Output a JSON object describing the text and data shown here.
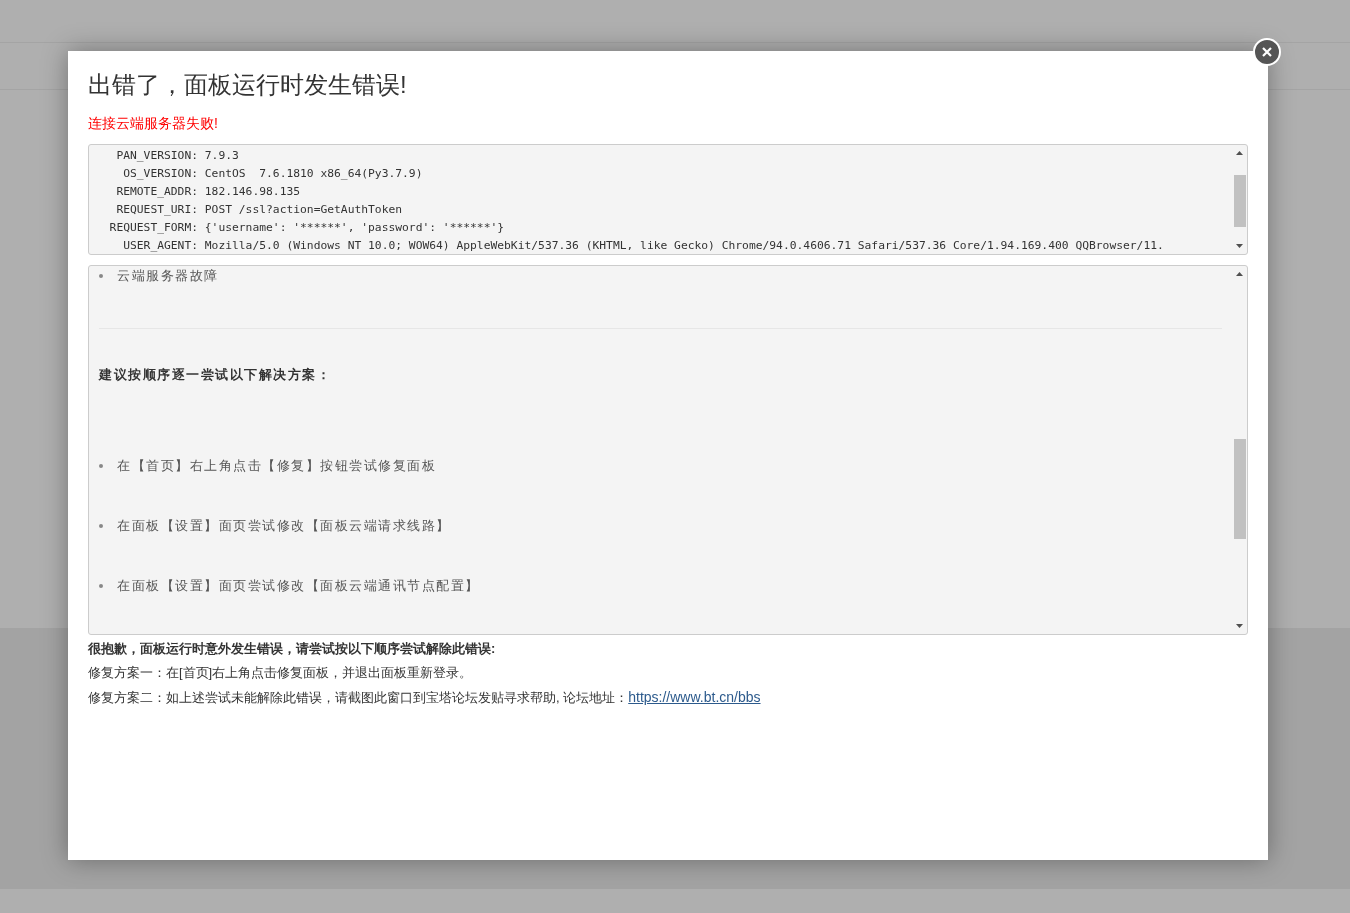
{
  "dialog": {
    "title": "出错了，面板运行时发生错误!",
    "error_message": "连接云端服务器失败!",
    "environment": [
      {
        "key": "PAN_VERSION:",
        "value": "7.9.3"
      },
      {
        "key": "OS_VERSION:",
        "value": "CentOS  7.6.1810 x86_64(Py3.7.9)"
      },
      {
        "key": "REMOTE_ADDR:",
        "value": "182.146.98.135"
      },
      {
        "key": "REQUEST_URI:",
        "value": "POST /ssl?action=GetAuthToken"
      },
      {
        "key": "REQUEST_FORM:",
        "value": "{'username': '******', 'password': '******'}"
      },
      {
        "key": "USER_AGENT:",
        "value": "Mozilla/5.0 (Windows NT 10.0; WOW64) AppleWebKit/537.36 (KHTML, like Gecko) Chrome/94.0.4606.71 Safari/537.36 Core/1.94.169.400 QQBrowser/11."
      }
    ],
    "causes": [
      "云端服务器故障"
    ],
    "solutions_heading": "建议按顺序逐一尝试以下解决方案：",
    "solutions": [
      "在【首页】右上角点击【修复】按钮尝试修复面板",
      "在面板【设置】面页尝试修改【面板云端请求线路】",
      "在面板【设置】面页尝试修改【面板云端通讯节点配置】"
    ],
    "apology": "很抱歉，面板运行时意外发生错误，请尝试按以下顺序尝试解除此错误:",
    "fix_one": "修复方案一：在[首页]右上角点击修复面板，并退出面板重新登录。",
    "fix_two": "修复方案二：如上述尝试未能解除此错误，请截图此窗口到宝塔论坛发贴寻求帮助, 论坛地址：",
    "forum_link": "https://www.bt.cn/bbs"
  }
}
